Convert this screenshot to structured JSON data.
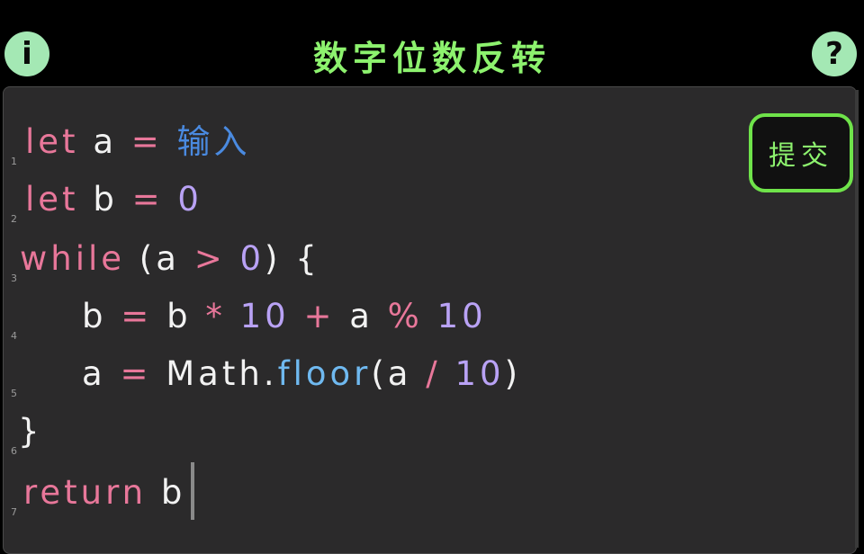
{
  "header": {
    "title": "数字位数反转",
    "info_label": "i",
    "help_label": "?"
  },
  "toolbar": {
    "submit_label": "提交"
  },
  "code_lines": [
    {
      "num": "1",
      "tokens": [
        {
          "t": "let",
          "c": "kw"
        },
        {
          "t": " a ",
          "c": "id"
        },
        {
          "t": "=",
          "c": "op"
        },
        {
          "t": " 输入",
          "c": "cn"
        }
      ]
    },
    {
      "num": "2",
      "tokens": [
        {
          "t": "let",
          "c": "kw"
        },
        {
          "t": " b ",
          "c": "id"
        },
        {
          "t": "=",
          "c": "op"
        },
        {
          "t": " 0",
          "c": "num"
        }
      ]
    },
    {
      "num": "3",
      "tokens": [
        {
          "t": "while",
          "c": "kw"
        },
        {
          "t": " (a ",
          "c": "id"
        },
        {
          "t": ">",
          "c": "op"
        },
        {
          "t": " 0",
          "c": "num"
        },
        {
          "t": ") {",
          "c": "id"
        }
      ]
    },
    {
      "num": "4",
      "tokens": [
        {
          "t": "    b ",
          "c": "id"
        },
        {
          "t": "=",
          "c": "op"
        },
        {
          "t": " b ",
          "c": "id"
        },
        {
          "t": "*",
          "c": "op"
        },
        {
          "t": " 10 ",
          "c": "num"
        },
        {
          "t": "+",
          "c": "op"
        },
        {
          "t": " a ",
          "c": "id"
        },
        {
          "t": "%",
          "c": "op"
        },
        {
          "t": " 10",
          "c": "num"
        }
      ]
    },
    {
      "num": "5",
      "tokens": [
        {
          "t": "    a ",
          "c": "id"
        },
        {
          "t": "=",
          "c": "op"
        },
        {
          "t": " Math.",
          "c": "id"
        },
        {
          "t": "floor",
          "c": "fn"
        },
        {
          "t": "(a ",
          "c": "id"
        },
        {
          "t": "/",
          "c": "op"
        },
        {
          "t": " 10",
          "c": "num"
        },
        {
          "t": ")",
          "c": "id"
        }
      ]
    },
    {
      "num": "6",
      "tokens": [
        {
          "t": "}",
          "c": "id"
        }
      ]
    },
    {
      "num": "7",
      "tokens": [
        {
          "t": "return",
          "c": "kw"
        },
        {
          "t": " b",
          "c": "id"
        }
      ]
    }
  ]
}
